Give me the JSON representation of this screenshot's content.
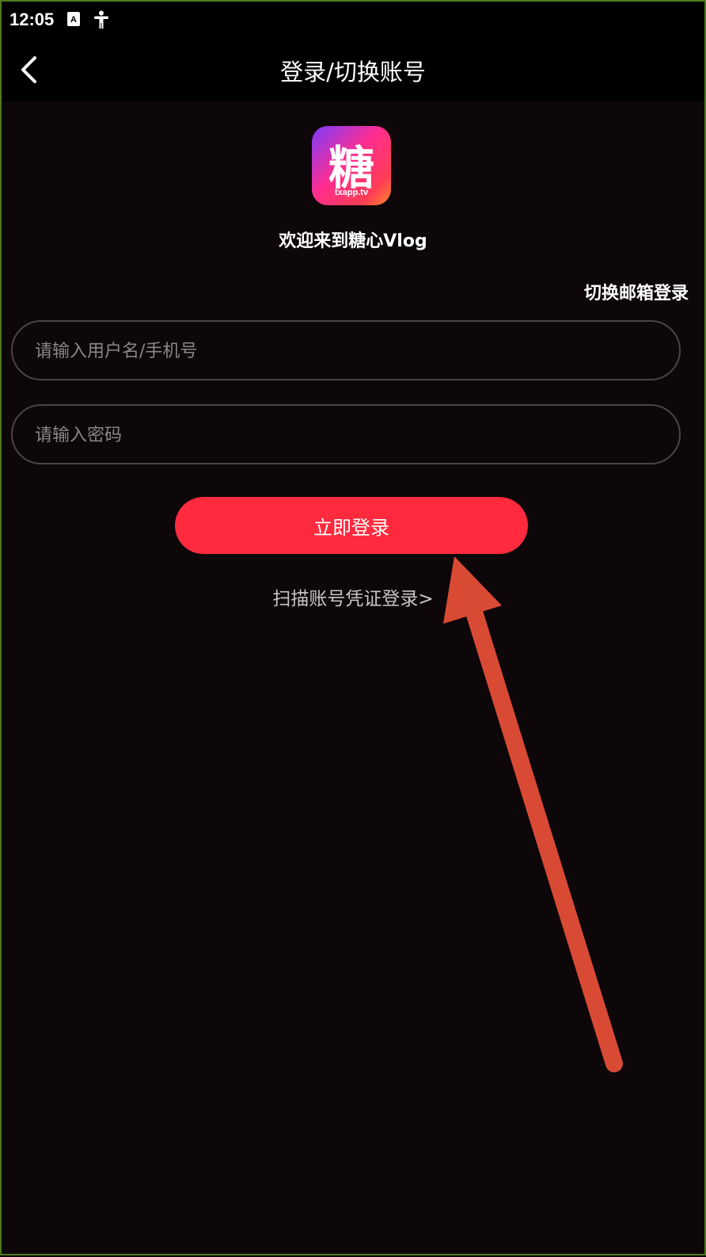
{
  "status_bar": {
    "time": "12:05",
    "icons": [
      "font-icon",
      "accessibility-icon"
    ]
  },
  "nav": {
    "back_icon": "chevron-left-icon",
    "title": "登录/切换账号"
  },
  "logo": {
    "glyph": "糖",
    "caption": "txapp.tv"
  },
  "welcome": "欢迎来到糖心Vlog",
  "switch_email": "切换邮箱登录",
  "username_input": {
    "placeholder": "请输入用户名/手机号",
    "value": ""
  },
  "password_input": {
    "placeholder": "请输入密码",
    "value": ""
  },
  "login_button": "立即登录",
  "scan_link": "扫描账号凭证登录>",
  "colors": {
    "background": "#0e0709",
    "bar": "#000000",
    "accent": "#ff2a3d",
    "annotation_arrow": "#d94a35"
  }
}
